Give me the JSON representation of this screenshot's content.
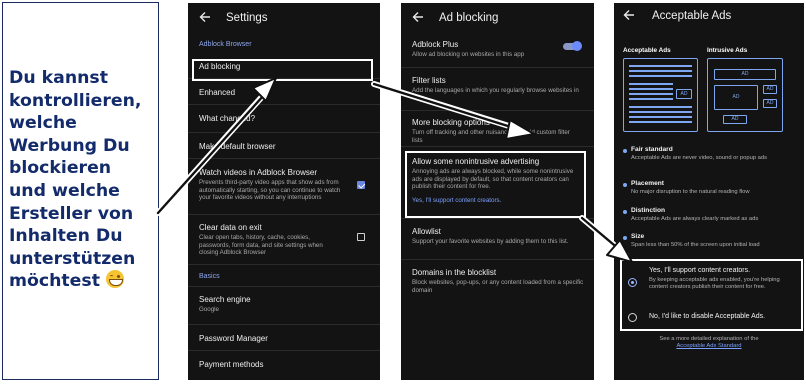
{
  "caption": {
    "lines": [
      "Du kannst",
      "kontrollieren,",
      "welche",
      "Werbung Du",
      "blockieren",
      "und welche",
      "Ersteller von",
      "Inhalten Du",
      "unterstützen",
      "möchtest"
    ],
    "emoji": "grinning-face"
  },
  "screen_settings": {
    "title": "Settings",
    "section_browser": "Adblock Browser",
    "items": {
      "ad_blocking": "Ad blocking",
      "enhanced": "Enhanced",
      "whats_changed": "What changed?",
      "default_browser": "Make default browser",
      "watch_videos": "Watch videos in Adblock Browser",
      "watch_videos_desc": "Prevents third-party video apps that show ads from automatically starting, so you can continue to watch your favorite videos without any interruptions",
      "clear_data": "Clear data on exit",
      "clear_data_desc": "Clear open tabs, history, cache, cookies, passwords, form data, and site settings when closing Adblock Browser",
      "search_engine": "Search engine",
      "search_engine_value": "Google",
      "password_manager": "Password Manager",
      "payment_methods": "Payment methods"
    },
    "section_basics": "Basics",
    "watch_videos_checked": true,
    "clear_data_checked": false
  },
  "screen_adblocking": {
    "title": "Ad blocking",
    "adblock_plus": "Adblock Plus",
    "adblock_plus_desc": "Allow ad blocking on websites in this app",
    "adblock_plus_on": true,
    "filter_lists": "Filter lists",
    "filter_lists_desc": "Add the languages in which you regularly browse websites in",
    "more_blocking": "More blocking options",
    "more_blocking_desc": "Turn off tracking and other nuisances, or add custom filter lists",
    "nonintrusive": "Allow some nonintrusive advertising",
    "nonintrusive_desc": "Annoying ads are always blocked, while some nonintrusive ads are displayed by default, so that content creators can publish their content for free.",
    "nonintrusive_link": "Yes, I'll support content creators.",
    "allowlist": "Allowlist",
    "allowlist_desc": "Support your favorite websites by adding them to this list.",
    "domains": "Domains in the blocklist",
    "domains_desc": "Block websites, pop-ups, or any content loaded from a specific domain"
  },
  "screen_acceptable": {
    "title": "Acceptable Ads",
    "label_acceptable": "Acceptable Ads",
    "label_intrusive": "Intrusive Ads",
    "ad_tag": "AD",
    "features": [
      {
        "title": "Fair standard",
        "desc": "Acceptable Ads are never video, sound or popup ads"
      },
      {
        "title": "Placement",
        "desc": "No major disruption to the natural reading flow"
      },
      {
        "title": "Distinction",
        "desc": "Acceptable Ads are always clearly marked as ads"
      },
      {
        "title": "Size",
        "desc": "Span less than 50% of the screen upon initial load"
      }
    ],
    "option_yes": "Yes, I'll support content creators.",
    "option_yes_desc": "By keeping acceptable ads enabled, you're helping content creators publish their content for free.",
    "option_no": "No, I'd like to disable Acceptable Ads.",
    "selected": "yes",
    "footer_text": "See a more detailed explanation of the",
    "footer_link": "Acceptable Ads Standard"
  },
  "colors": {
    "caption_text": "#132b6b",
    "screen_bg": "#131313",
    "accent_blue": "#7aa0ff",
    "highlight": "#ffffff"
  }
}
